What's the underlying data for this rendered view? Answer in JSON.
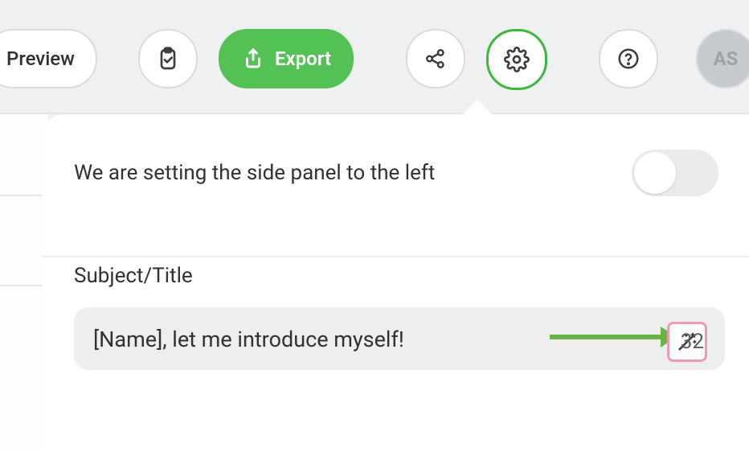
{
  "toolbar": {
    "preview_label": "Preview",
    "export_label": "Export",
    "avatar_initials": "AS"
  },
  "panel": {
    "toggle_label": "We are setting the side panel to the left",
    "toggle_on": false,
    "subject_section_title": "Subject/Title",
    "subject_value": "[Name], let me introduce myself!",
    "subject_char_count": "32"
  }
}
